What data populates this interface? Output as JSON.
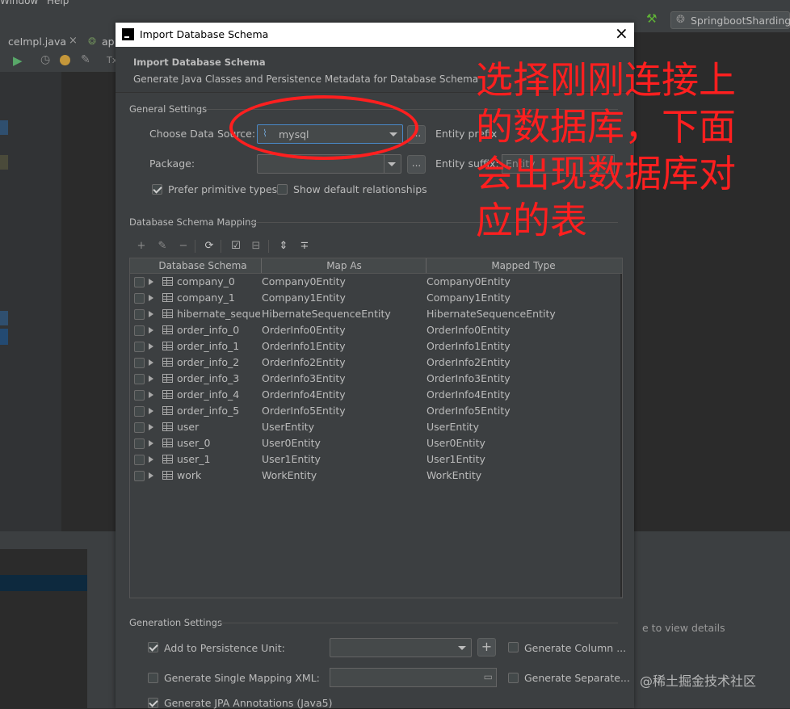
{
  "ide": {
    "menu": {
      "window": "Window",
      "help": "Help"
    },
    "run_config": "SpringbootShardingA",
    "tabs": [
      "ceImpl.java",
      "ap"
    ],
    "runbar_extra": "Tx",
    "behind_text": "e to view details"
  },
  "dialog": {
    "title": "Import Database Schema",
    "header_title": "Import Database Schema",
    "header_subtitle": "Generate Java Classes and Persistence Metadata for Database Schema",
    "general": {
      "section": "General Settings",
      "data_source_label": "Choose Data Source:",
      "data_source_value": "mysql",
      "package_label": "Package:",
      "package_value": "",
      "entity_prefix_label": "Entity prefix",
      "entity_suffix_label": "Entity suffix:",
      "entity_suffix_value": "Entity",
      "prefer_primitive_label": "Prefer primitive types",
      "prefer_primitive_checked": true,
      "show_default_label": "Show default relationships",
      "show_default_checked": false
    },
    "mapping": {
      "section": "Database Schema Mapping",
      "toolbar": [
        "add-icon",
        "edit-icon",
        "remove-icon",
        "refresh-icon",
        "check-all-icon",
        "uncheck-all-icon",
        "expand-all-icon",
        "collapse-all-icon"
      ],
      "columns": [
        "Database Schema",
        "Map As",
        "Mapped Type"
      ],
      "rows": [
        {
          "schema": "company_0",
          "map_as": "Company0Entity",
          "type": "Company0Entity"
        },
        {
          "schema": "company_1",
          "map_as": "Company1Entity",
          "type": "Company1Entity"
        },
        {
          "schema": "hibernate_sequen",
          "map_as": "HibernateSequenceEntity",
          "type": "HibernateSequenceEntity"
        },
        {
          "schema": "order_info_0",
          "map_as": "OrderInfo0Entity",
          "type": "OrderInfo0Entity"
        },
        {
          "schema": "order_info_1",
          "map_as": "OrderInfo1Entity",
          "type": "OrderInfo1Entity"
        },
        {
          "schema": "order_info_2",
          "map_as": "OrderInfo2Entity",
          "type": "OrderInfo2Entity"
        },
        {
          "schema": "order_info_3",
          "map_as": "OrderInfo3Entity",
          "type": "OrderInfo3Entity"
        },
        {
          "schema": "order_info_4",
          "map_as": "OrderInfo4Entity",
          "type": "OrderInfo4Entity"
        },
        {
          "schema": "order_info_5",
          "map_as": "OrderInfo5Entity",
          "type": "OrderInfo5Entity"
        },
        {
          "schema": "user",
          "map_as": "UserEntity",
          "type": "UserEntity"
        },
        {
          "schema": "user_0",
          "map_as": "User0Entity",
          "type": "User0Entity"
        },
        {
          "schema": "user_1",
          "map_as": "User1Entity",
          "type": "User1Entity"
        },
        {
          "schema": "work",
          "map_as": "WorkEntity",
          "type": "WorkEntity"
        }
      ]
    },
    "generation": {
      "section": "Generation Settings",
      "add_persistence_label": "Add to Persistence Unit:",
      "add_persistence_checked": true,
      "generate_column_label": "Generate Column ...",
      "single_mapping_label": "Generate Single Mapping XML:",
      "single_mapping_checked": false,
      "generate_separate_label": "Generate Separate...",
      "jpa_annotations_label": "Generate JPA Annotations (Java5)",
      "jpa_annotations_checked": true
    }
  },
  "annotation": {
    "lines": [
      "选择刚刚连接上",
      "的数据库，下面",
      "会出现数据库对",
      "应的表"
    ],
    "color": "#ff1f1f"
  },
  "watermark": "@稀土掘金技术社区"
}
